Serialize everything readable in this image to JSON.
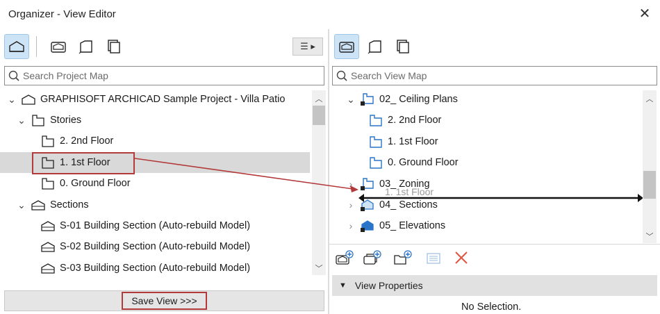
{
  "window": {
    "title": "Organizer - View Editor",
    "close_glyph": "✕"
  },
  "left": {
    "toolbar": {
      "icons": [
        "project-map-icon",
        "view-map-icon",
        "layout-book-icon",
        "publisher-icon"
      ],
      "menu_glyph": "☰ ▸"
    },
    "search": {
      "placeholder": "Search Project Map"
    },
    "tree": [
      {
        "label": "GRAPHISOFT ARCHICAD Sample Project - Villa Patio",
        "icon": "project-icon",
        "expanded": true
      },
      {
        "label": "Stories",
        "icon": "story-icon",
        "expanded": true
      },
      {
        "label": "2. 2nd Floor",
        "icon": "floor-plan-icon"
      },
      {
        "label": "1. 1st Floor",
        "icon": "floor-plan-icon",
        "selected": true
      },
      {
        "label": "0. Ground Floor",
        "icon": "floor-plan-icon"
      },
      {
        "label": "Sections",
        "icon": "section-icon",
        "expanded": true
      },
      {
        "label": "S-01 Building Section (Auto-rebuild Model)",
        "icon": "section-icon"
      },
      {
        "label": "S-02 Building Section (Auto-rebuild Model)",
        "icon": "section-icon"
      },
      {
        "label": "S-03 Building Section (Auto-rebuild Model)",
        "icon": "section-icon"
      }
    ],
    "save_view_label": "Save View >>>"
  },
  "right": {
    "toolbar": {
      "icons": [
        "view-map-icon",
        "layout-book-icon",
        "publisher-icon"
      ]
    },
    "search": {
      "placeholder": "Search View Map"
    },
    "tree": [
      {
        "label": "02_ Ceiling Plans",
        "icon": "folder-floor-plan-icon",
        "expanded": true
      },
      {
        "label": "2. 2nd Floor",
        "icon": "floor-plan-icon"
      },
      {
        "label": "1. 1st Floor",
        "icon": "floor-plan-icon"
      },
      {
        "label": "0. Ground Floor",
        "icon": "floor-plan-icon"
      },
      {
        "label": "03_ Zoning",
        "icon": "folder-floor-plan-icon",
        "expanded": false
      },
      {
        "label": "04_ Sections",
        "icon": "folder-section-icon",
        "expanded": false
      },
      {
        "label": "05_ Elevations",
        "icon": "folder-elevation-icon",
        "expanded": false
      }
    ],
    "drag_ghost": "1. 1st Floor",
    "actions": [
      "new-view-icon",
      "new-clone-icon",
      "new-folder-icon",
      "settings-icon",
      "delete-icon"
    ],
    "view_properties": {
      "header": "View Properties",
      "status": "No Selection."
    }
  },
  "colors": {
    "selection": "#d9d9d9",
    "active_tool": "#cde4f7",
    "highlight_box": "#b33a3a",
    "icon_blue": "#2a74c9",
    "delete_red": "#e0533d"
  }
}
